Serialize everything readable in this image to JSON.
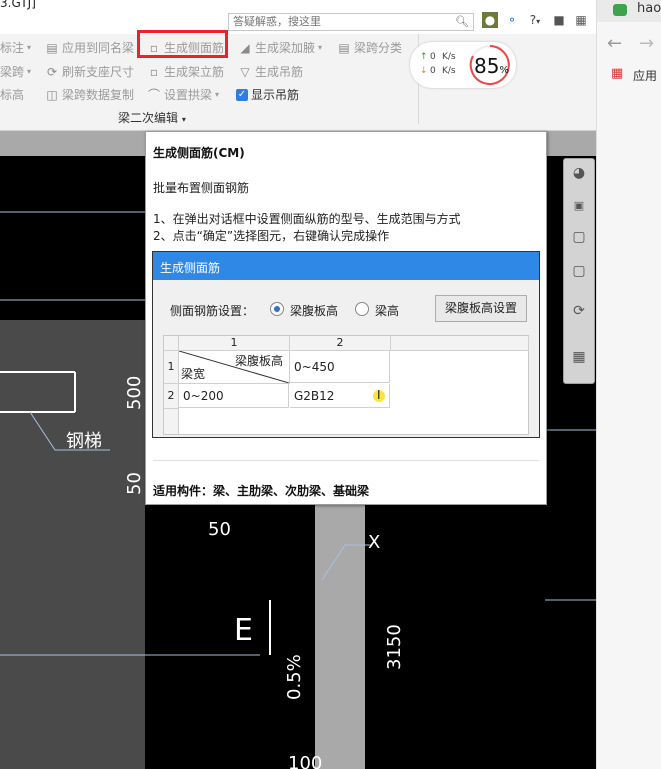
{
  "window": {
    "title_fragment": "3.GTJ]"
  },
  "search": {
    "placeholder": "答疑解惑，搜这里"
  },
  "top_icons": [
    "avatar-icon",
    "headset-icon",
    "help-icon",
    "shirt-icon",
    "gift-icon"
  ],
  "help_label": "?",
  "ribbon": {
    "row1": [
      {
        "label": "标注",
        "icon": "tag-icon",
        "dropdown": true
      },
      {
        "label": "应用到同名梁",
        "icon": "copy-icon"
      },
      {
        "label": "生成侧面筋",
        "icon": "side-rebar-icon",
        "highlighted": true
      },
      {
        "label": "生成梁加腋",
        "icon": "haunch-icon",
        "dropdown": true
      },
      {
        "label": "梁跨分类",
        "icon": "span-class-icon"
      }
    ],
    "row2": [
      {
        "label": "梁跨",
        "icon": "span-icon",
        "dropdown": true
      },
      {
        "label": "刷新支座尺寸",
        "icon": "refresh-icon"
      },
      {
        "label": "生成架立筋",
        "icon": "erect-rebar-icon"
      },
      {
        "label": "生成吊筋",
        "icon": "hanger-icon"
      }
    ],
    "row3": [
      {
        "label": "标高",
        "icon": "elevation-icon"
      },
      {
        "label": "梁跨数据复制",
        "icon": "span-copy-icon"
      },
      {
        "label": "设置拱梁",
        "icon": "arch-icon",
        "dropdown": true
      },
      {
        "label": "显示吊筋",
        "icon": "checkbox-icon",
        "checked": true
      }
    ],
    "group_label": "梁二次编辑"
  },
  "speed": {
    "up": "0",
    "down": "0",
    "unit": "K/s",
    "percent": "85",
    "percent_sign": "%"
  },
  "browser": {
    "tab_text": "hao",
    "apps_label": "应用"
  },
  "tooltip": {
    "title": "生成侧面筋(CM)",
    "description": "批量布置侧面钢筋",
    "step1": "1、在弹出对话框中设置侧面纵筋的型号、生成范围与方式",
    "step2": "2、点击“确定”选择图元，右键确认完成操作",
    "applicable": "适用构件：梁、主肋梁、次肋梁、基础梁"
  },
  "dialog": {
    "title": "生成侧面筋",
    "setting_label": "侧面钢筋设置：",
    "option_web_height": "梁腹板高",
    "option_beam_height": "梁高",
    "selected": "梁腹板高",
    "button_label": "梁腹板高设置",
    "grid": {
      "col_headers": [
        "1",
        "2"
      ],
      "row_headers": [
        "1",
        "2"
      ],
      "header_top": "梁腹板高",
      "header_bottom": "梁宽",
      "rows": [
        {
          "c1": "",
          "c2": "0~450"
        },
        {
          "c1": "0~200",
          "c2": "G2B12"
        }
      ]
    }
  },
  "cad": {
    "labels": [
      "钢梯",
      "500",
      "50",
      "50",
      "X",
      "E",
      "0.5%",
      "3150",
      "100"
    ]
  },
  "right_toolbar": [
    "globe-icon",
    "cube-3d-icon",
    "cube-icon",
    "cube-dropdown-icon",
    "rotate-icon",
    "table-icon"
  ]
}
